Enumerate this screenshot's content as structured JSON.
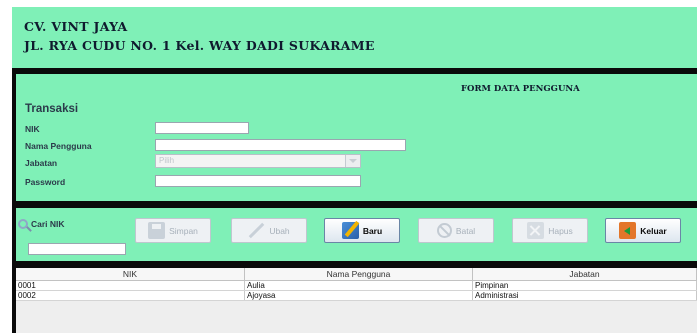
{
  "header": {
    "company_name": "CV. VINT JAYA",
    "address": "JL. RYA CUDU NO. 1 Kel. WAY DADI SUKARAME"
  },
  "form": {
    "title": "FORM DATA PENGGUNA",
    "section": "Transaksi",
    "labels": {
      "nik": "NIK",
      "nama": "Nama Pengguna",
      "jabatan": "Jabatan",
      "password": "Password"
    },
    "jabatan_selected": "Pilih",
    "nik_value": "",
    "nama_value": "",
    "password_value": ""
  },
  "toolbar": {
    "cari_label": "Cari NIK",
    "cari_value": "",
    "buttons": [
      {
        "label": "Simpan",
        "icon": "save-icon",
        "enabled": false
      },
      {
        "label": "Ubah",
        "icon": "edit-icon",
        "enabled": false
      },
      {
        "label": "Baru",
        "icon": "new-icon",
        "enabled": true
      },
      {
        "label": "Batal",
        "icon": "cancel-icon",
        "enabled": false
      },
      {
        "label": "Hapus",
        "icon": "delete-icon",
        "enabled": false
      },
      {
        "label": "Keluar",
        "icon": "exit-icon",
        "enabled": true
      }
    ]
  },
  "table": {
    "columns": [
      "NIK",
      "Nama Pengguna",
      "Jabatan"
    ],
    "rows": [
      [
        "0001",
        "Aulia",
        "Pimpinan"
      ],
      [
        "0002",
        "Ajoyasa",
        "Administrasi"
      ]
    ]
  },
  "colors": {
    "panel": "#7ff0b7",
    "frame": "#0a0a0a"
  }
}
